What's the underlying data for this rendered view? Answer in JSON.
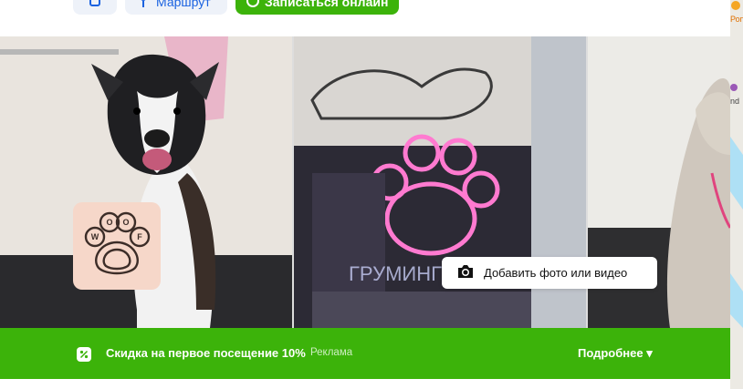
{
  "top_actions": {
    "route_label": "Маршрут",
    "book_label": "Записаться онлайн"
  },
  "gallery": {
    "photo_1_alt": "",
    "photo_2_alt": "",
    "photo_3_alt": "",
    "logo_text": "WOOF",
    "add_photo_label": "Добавить фото или видео"
  },
  "promo": {
    "text": "Скидка на первое посещение 10%",
    "ad_label": "Реклама",
    "more_label": "Подробнее ▾"
  },
  "map_fragment": {
    "label_top": "Роп",
    "label_mid": "nd"
  },
  "colors": {
    "accent_green": "#3cb30a",
    "link_blue": "#1a62e0",
    "logo_bg": "#f6d7c9"
  }
}
